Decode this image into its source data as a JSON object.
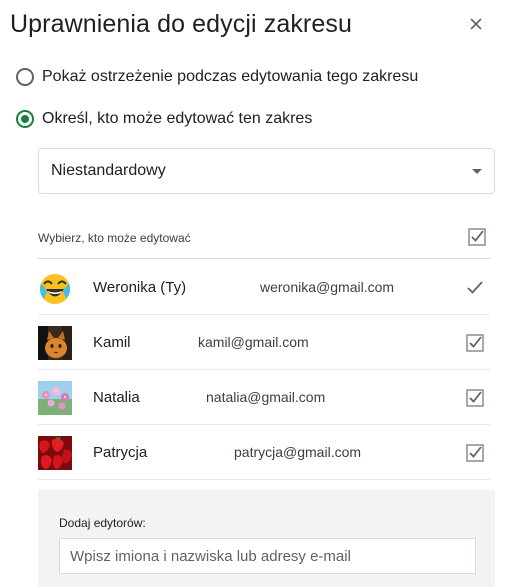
{
  "dialog": {
    "title": "Uprawnienia do edycji zakresu",
    "close_icon": "close-icon"
  },
  "options": [
    {
      "label": "Pokaż ostrzeżenie podczas edytowania tego zakresu",
      "checked": false
    },
    {
      "label": "Określ, kto może edytować ten zakres",
      "checked": true
    }
  ],
  "select": {
    "value": "Niestandardowy",
    "caret_icon": "caret-down-icon"
  },
  "editors": {
    "header_label": "Wybierz, kto może edytować",
    "all_checked": true,
    "users": [
      {
        "name": "Weronika (Ty)",
        "email": "weronika@gmail.com",
        "avatar": "laughing-emoji-avatar",
        "checked": true
      },
      {
        "name": "Kamil",
        "email": "kamil@gmail.com",
        "avatar": "cat-photo-avatar",
        "checked": true
      },
      {
        "name": "Natalia",
        "email": "natalia@gmail.com",
        "avatar": "flowers-photo-avatar",
        "checked": true
      },
      {
        "name": "Patrycja",
        "email": "patrycja@gmail.com",
        "avatar": "strawberries-photo-avatar",
        "checked": true
      }
    ]
  },
  "add_editors": {
    "label": "Dodaj edytorów:",
    "placeholder": "Wpisz imiona i nazwiska lub adresy e-mail",
    "value": ""
  },
  "colors": {
    "accent": "#188038",
    "border": "#dadce0",
    "panel": "#f1f3f4",
    "text": "#202124"
  }
}
